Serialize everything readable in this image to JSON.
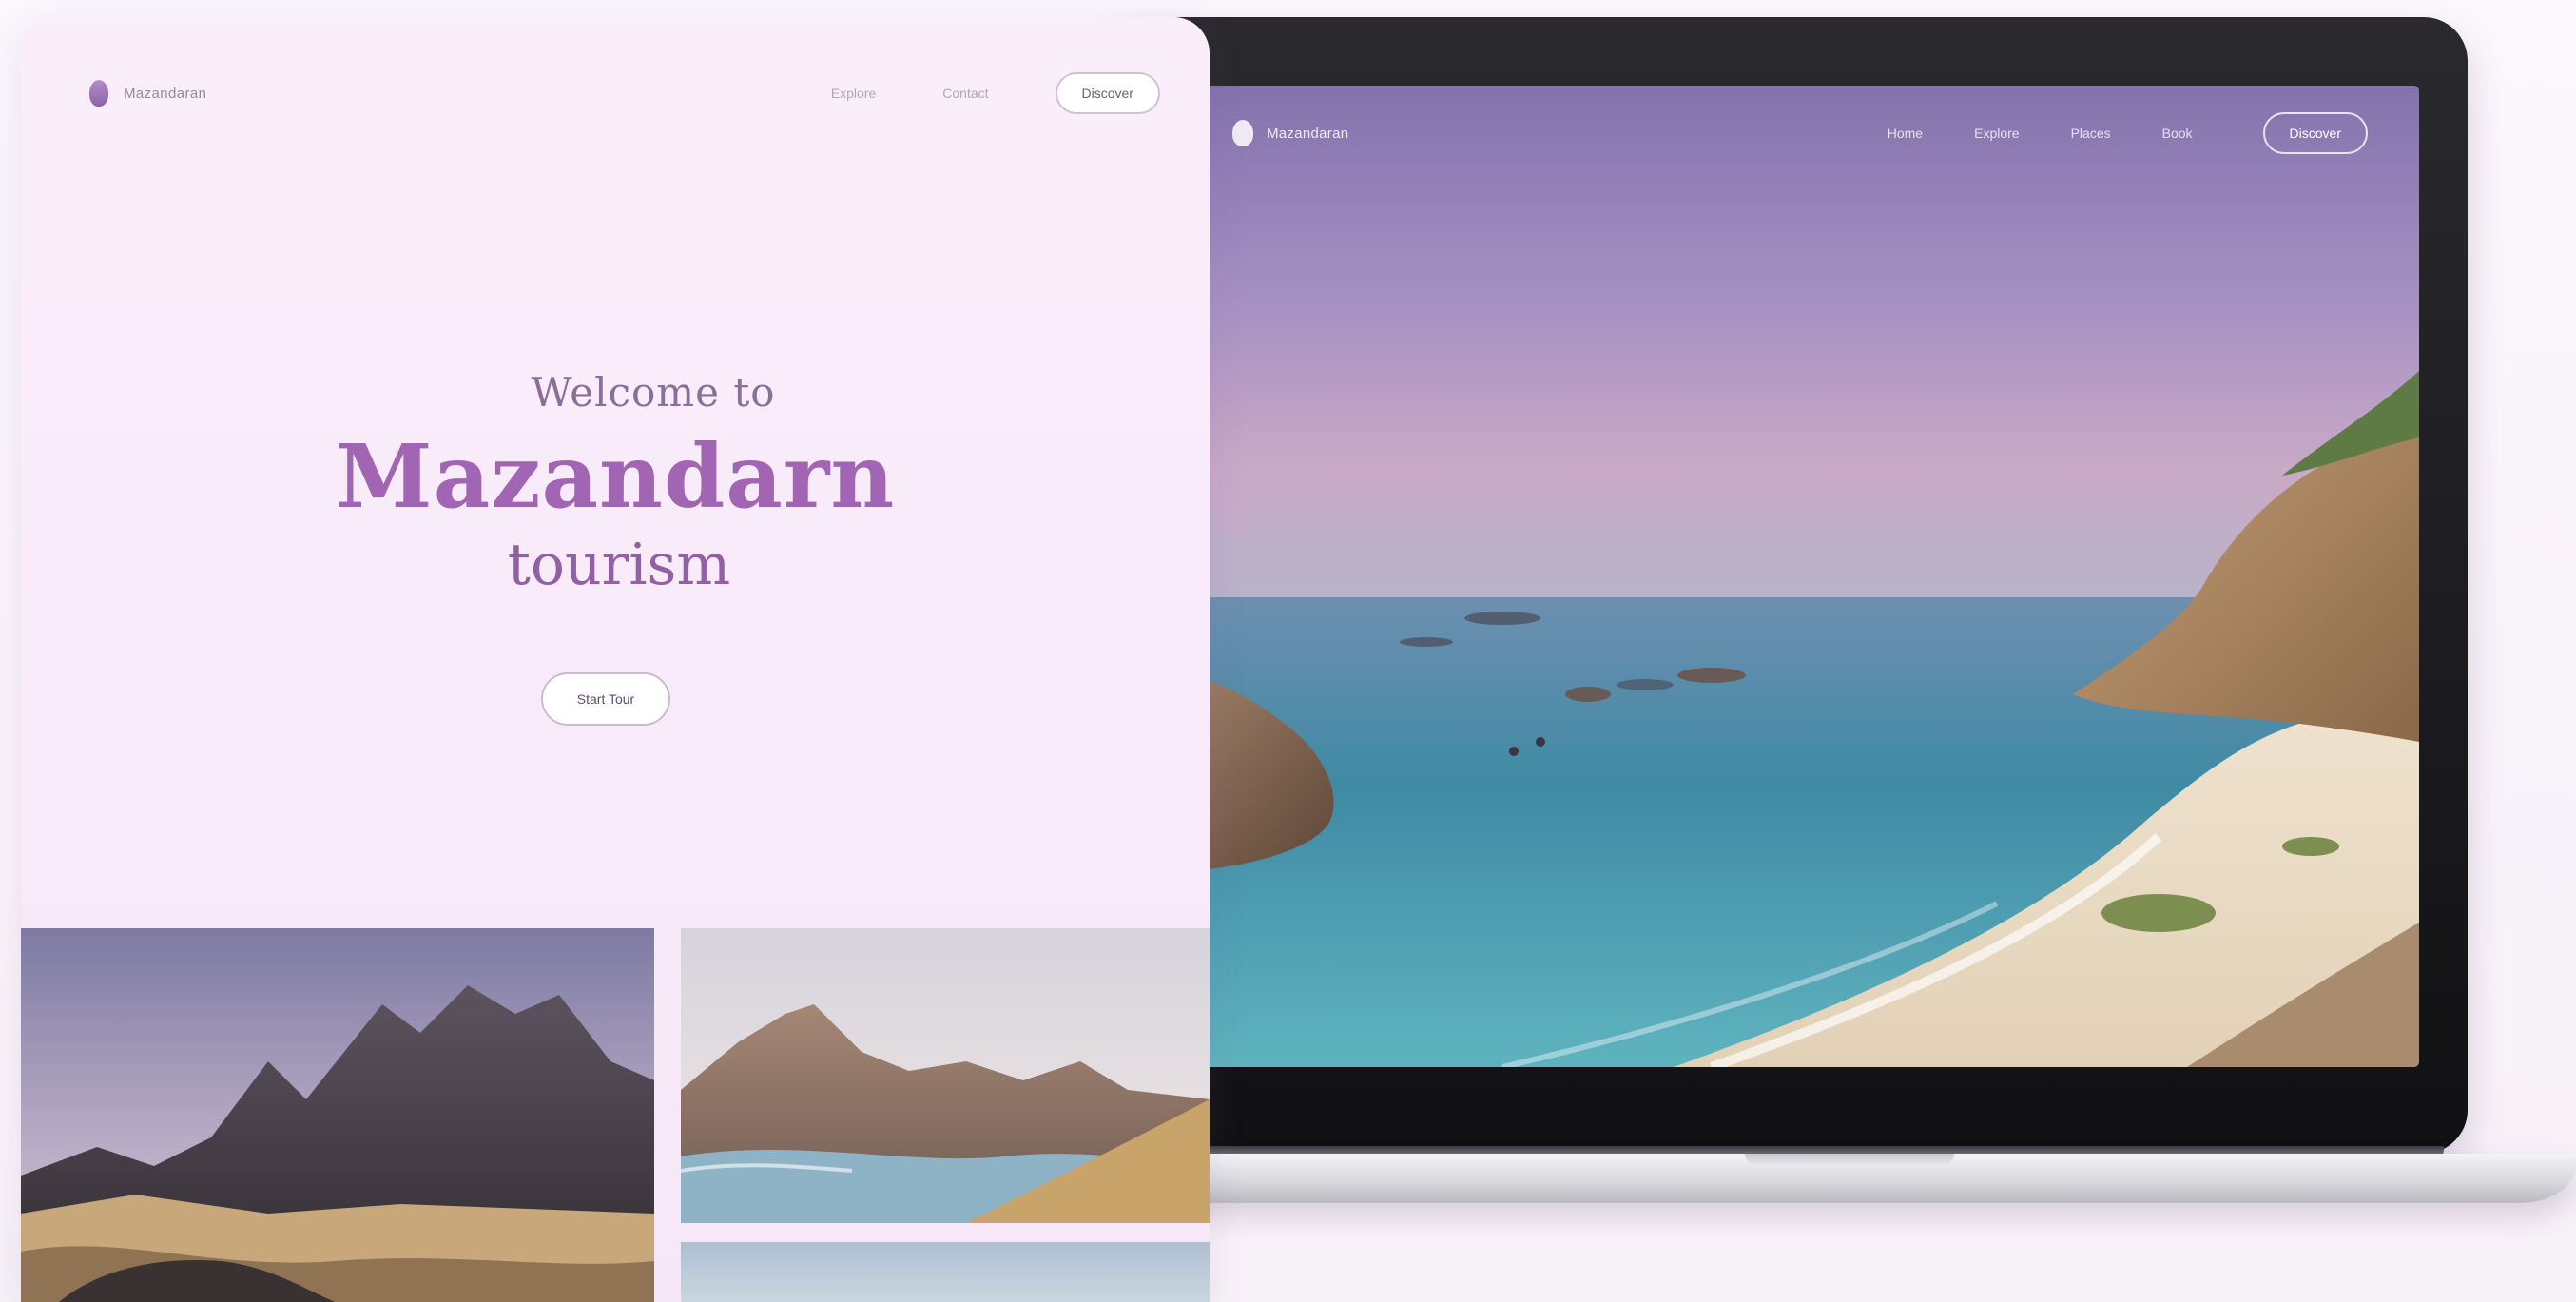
{
  "landing_card": {
    "logo_text": "Mazandaran",
    "nav": [
      "Explore",
      "Contact"
    ],
    "nav_cta": "Discover",
    "hero": {
      "welcome": "Welcome to",
      "title": "Mazandarn",
      "subtitle": "tourism"
    },
    "hero_cta": "Start Tour",
    "gallery": [
      "mountain-peaks-image",
      "mountain-lake-image",
      "water-image"
    ]
  },
  "laptop_site": {
    "logo_text": "Mazandaran",
    "nav": [
      "Home",
      "Explore",
      "Places",
      "Book"
    ],
    "nav_cta": "Discover"
  },
  "colors": {
    "card_bg": "#fbeefb",
    "title_accent": "#a265b3",
    "sky_top": "#8e7bb0",
    "sea": "#3d8fa3",
    "sand": "#e9dcc6"
  }
}
